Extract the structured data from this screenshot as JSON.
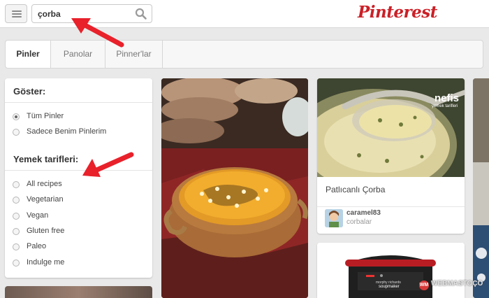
{
  "header": {
    "search_value": "çorba",
    "logo_text": "Pinterest"
  },
  "tabs": [
    {
      "label": "Pinler",
      "active": true
    },
    {
      "label": "Panolar",
      "active": false
    },
    {
      "label": "Pinner'lar",
      "active": false
    }
  ],
  "filter": {
    "show_title": "Göster:",
    "show_options": [
      {
        "label": "Tüm Pinler",
        "checked": true
      },
      {
        "label": "Sadece Benim Pinlerim",
        "checked": false
      }
    ],
    "recipes_title": "Yemek tarifleri:",
    "recipe_options": [
      {
        "label": "All recipes",
        "checked": false
      },
      {
        "label": "Vegetarian",
        "checked": false
      },
      {
        "label": "Vegan",
        "checked": false
      },
      {
        "label": "Gluten free",
        "checked": false
      },
      {
        "label": "Paleo",
        "checked": false
      },
      {
        "label": "Indulge me",
        "checked": false
      }
    ]
  },
  "pins": {
    "second": {
      "title": "Patlıcanlı Çorba",
      "user": "caramel83",
      "board": "corbalar",
      "image_overlay": "nefis",
      "image_overlay_sub": "yemek tarifleri"
    },
    "third": {
      "product_brand": "morphy richards",
      "product_name": "soupmaker"
    }
  },
  "watermark": {
    "badge": "WM",
    "text": "WEBMASTO",
    "suffix": "ÇO"
  },
  "colors": {
    "brand": "#cb2027",
    "arrow": "#e8212b"
  }
}
